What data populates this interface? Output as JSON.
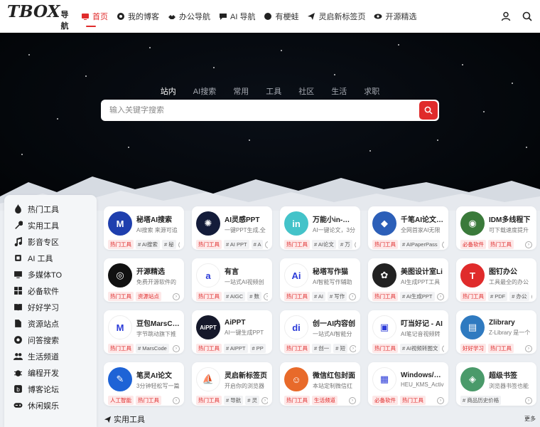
{
  "logo": {
    "big": "TBOX",
    "small": "导航"
  },
  "nav": [
    {
      "label": "首页",
      "icon": "monitor-icon",
      "active": true
    },
    {
      "label": "我的博客",
      "icon": "globe-icon"
    },
    {
      "label": "办公导航",
      "icon": "handshake-icon"
    },
    {
      "label": "AI 导航",
      "icon": "chat-icon"
    },
    {
      "label": "有梗蛙",
      "icon": "circle-icon"
    },
    {
      "label": "灵启新标签页",
      "icon": "send-icon"
    },
    {
      "label": "开源精选",
      "icon": "eye-icon"
    }
  ],
  "search": {
    "tabs": [
      "站内",
      "AI搜索",
      "常用",
      "工具",
      "社区",
      "生活",
      "求职"
    ],
    "active_tab": 0,
    "placeholder": "输入关键字搜索"
  },
  "sidebar": {
    "items": [
      {
        "label": "热门工具",
        "icon": "fire-icon"
      },
      {
        "label": "实用工具",
        "icon": "wrench-icon"
      },
      {
        "label": "影音专区",
        "icon": "music-icon"
      },
      {
        "label": "AI 工具",
        "icon": "chip-icon"
      },
      {
        "label": "多媒体TO",
        "icon": "screen-icon"
      },
      {
        "label": "必备软件",
        "icon": "windows-icon"
      },
      {
        "label": "好好学习",
        "icon": "book-icon"
      },
      {
        "label": "资源站点",
        "icon": "file-icon"
      },
      {
        "label": "问答搜索",
        "icon": "chrome-icon"
      },
      {
        "label": "生活频道",
        "icon": "people-icon"
      },
      {
        "label": "编程开发",
        "icon": "bug-icon"
      },
      {
        "label": "博客论坛",
        "icon": "blog-icon"
      },
      {
        "label": "休闲娱乐",
        "icon": "gamepad-icon"
      }
    ]
  },
  "cards": [
    {
      "title": "秘塔AI搜索",
      "desc": "AI搜索 来源可追",
      "tags": [
        "热门工具",
        "# AI搜索",
        "# 秘"
      ],
      "logo_color": "#1f3fae",
      "logo_text": "M"
    },
    {
      "title": "AI灵感PPT",
      "desc": "一键PPT生成,全",
      "tags": [
        "热门工具",
        "# AI PPT",
        "# A"
      ],
      "logo_color": "#141c3a",
      "logo_text": "✺"
    },
    {
      "title": "万能小in-论文",
      "desc": "AI一键论文，3分",
      "tags": [
        "热门工具",
        "# AI论文",
        "# 万"
      ],
      "logo_color": "#44c3c9",
      "logo_text": "in"
    },
    {
      "title": "千笔AI论文-AI",
      "desc": "全网首家AI无限",
      "tags": [
        "热门工具",
        "# AIPaperPass"
      ],
      "logo_color": "#2c5fb8",
      "logo_text": "◆"
    },
    {
      "title": "IDM多线程下",
      "desc": "可下载速度提升",
      "tags": [
        "必备软件",
        "热门工具"
      ],
      "logo_color": "#3a7a3a",
      "logo_text": "◉"
    },
    {
      "title": "开源精选",
      "desc": "免费开源软件的",
      "tags": [
        "热门工具",
        "资源站点"
      ],
      "logo_color": "#111111",
      "logo_text": "◎"
    },
    {
      "title": "有言",
      "desc": "一站式AI视频创",
      "tags": [
        "热门工具",
        "# AIGC",
        "# 数"
      ],
      "logo_color": "#ffffff",
      "logo_text": "a"
    },
    {
      "title": "秘塔写作猫",
      "desc": "AI智能写作辅助",
      "tags": [
        "热门工具",
        "# AI",
        "# 写作"
      ],
      "logo_color": "#ffffff",
      "logo_text": "Ai"
    },
    {
      "title": "美图设计室Li",
      "desc": "AI生成PPT工具",
      "tags": [
        "热门工具",
        "# AI生成PPT"
      ],
      "logo_color": "#222222",
      "logo_text": "✿"
    },
    {
      "title": "图钉办公",
      "desc": "工具最全的办公",
      "tags": [
        "热门工具",
        "# PDF",
        "# 办公"
      ],
      "logo_color": "#e02b2b",
      "logo_text": "T"
    },
    {
      "title": "豆包MarsCod",
      "desc": "字节跳动旗下推",
      "tags": [
        "热门工具",
        "# MarsCode"
      ],
      "logo_color": "#ffffff",
      "logo_text": "M"
    },
    {
      "title": "AiPPT",
      "desc": "AI一键生成PPT",
      "tags": [
        "热门工具",
        "# AIPPT",
        "# PP"
      ],
      "logo_color": "#15182a",
      "logo_text": "AiPPT"
    },
    {
      "title": "创一AI内容创",
      "desc": "一站式AI智能分",
      "tags": [
        "热门工具",
        "# 创一",
        "# 短"
      ],
      "logo_color": "#ffffff",
      "logo_text": "di"
    },
    {
      "title": "叮当好记 - AI",
      "desc": "AI笔记音视频转",
      "tags": [
        "热门工具",
        "# AI视频转图文"
      ],
      "logo_color": "#ffffff",
      "logo_text": "▣"
    },
    {
      "title": "Zlibrary",
      "desc": "Z-Library 是一个",
      "tags": [
        "好好学习",
        "热门工具"
      ],
      "logo_color": "#2f7ac0",
      "logo_text": "▤"
    },
    {
      "title": "笔灵AI论文",
      "desc": "3分钟轻松写一篇",
      "tags": [
        "人工智能",
        "热门工具"
      ],
      "logo_color": "#1e63d6",
      "logo_text": "✎"
    },
    {
      "title": "灵启新标签页",
      "desc": "开启你的浏览器",
      "tags": [
        "热门工具",
        "# 导航",
        "# 灵"
      ],
      "logo_color": "#ffffff",
      "logo_text": "⛵"
    },
    {
      "title": "微信红包封面",
      "desc": "本站定制微信红",
      "tags": [
        "热门工具",
        "生活频道"
      ],
      "logo_color": "#e86a2a",
      "logo_text": "☺"
    },
    {
      "title": "Windows/Offi",
      "desc": "HEU_KMS_Activ",
      "tags": [
        "必备软件",
        "热门工具"
      ],
      "logo_color": "#ffffff",
      "logo_text": "▦"
    },
    {
      "title": "超级书签",
      "desc": "浏览器书签也能",
      "tags": [
        "# 商品历史价格"
      ],
      "logo_color": "#4a9a6a",
      "logo_text": "◈"
    }
  ],
  "section": {
    "title": "实用工具",
    "more": "更多"
  }
}
